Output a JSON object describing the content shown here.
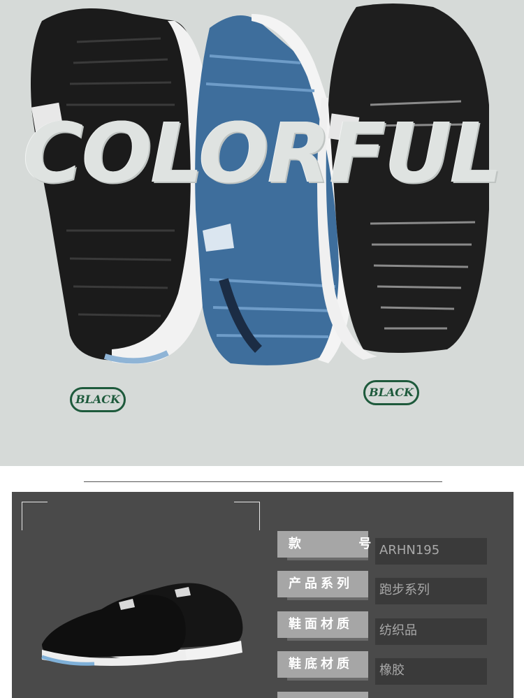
{
  "hero": {
    "headline": "COLORFUL",
    "tags": [
      "BLACK",
      "BLACK"
    ]
  },
  "specs": [
    {
      "label": "款  号",
      "value": "ARHN195"
    },
    {
      "label": "产品系列",
      "value": "跑步系列"
    },
    {
      "label": "鞋面材质",
      "value": "纺织品"
    },
    {
      "label": "鞋底材质",
      "value": "橡胶"
    }
  ],
  "colors": {
    "hero_bg": "#d6dad8",
    "tag_green": "#1e5a3c",
    "panel_bg": "#4a4a4a",
    "label_bg": "#a6a6a6"
  }
}
